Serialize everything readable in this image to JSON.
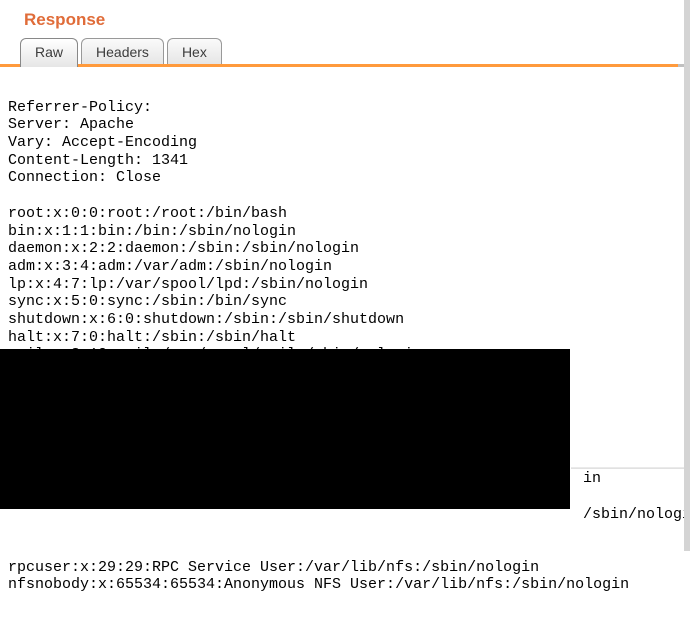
{
  "header": {
    "title": "Response"
  },
  "tabs": {
    "raw": "Raw",
    "headers": "Headers",
    "hex": "Hex"
  },
  "body": {
    "headers_block": "Referrer-Policy:\nServer: Apache\nVary: Accept-Encoding\nContent-Length: 1341\nConnection: Close",
    "passwd_block": "root:x:0:0:root:/root:/bin/bash\nbin:x:1:1:bin:/bin:/sbin/nologin\ndaemon:x:2:2:daemon:/sbin:/sbin/nologin\nadm:x:3:4:adm:/var/adm:/sbin/nologin\nlp:x:4:7:lp:/var/spool/lpd:/sbin/nologin\nsync:x:5:0:sync:/sbin:/bin/sync\nshutdown:x:6:0:shutdown:/sbin:/sbin/shutdown\nhalt:x:7:0:halt:/sbin:/sbin/halt\nmail:x:8:12:mail:/var/spool/mail:/sbin/nologin",
    "partial_right_1": "in",
    "partial_right_2": "/sbin/nologin",
    "tail_line_1": "rpcuser:x:29:29:RPC Service User:/var/lib/nfs:/sbin/nologin",
    "tail_line_2": "nfsnobody:x:65534:65534:Anonymous NFS User:/var/lib/nfs:/sbin/nologin"
  }
}
